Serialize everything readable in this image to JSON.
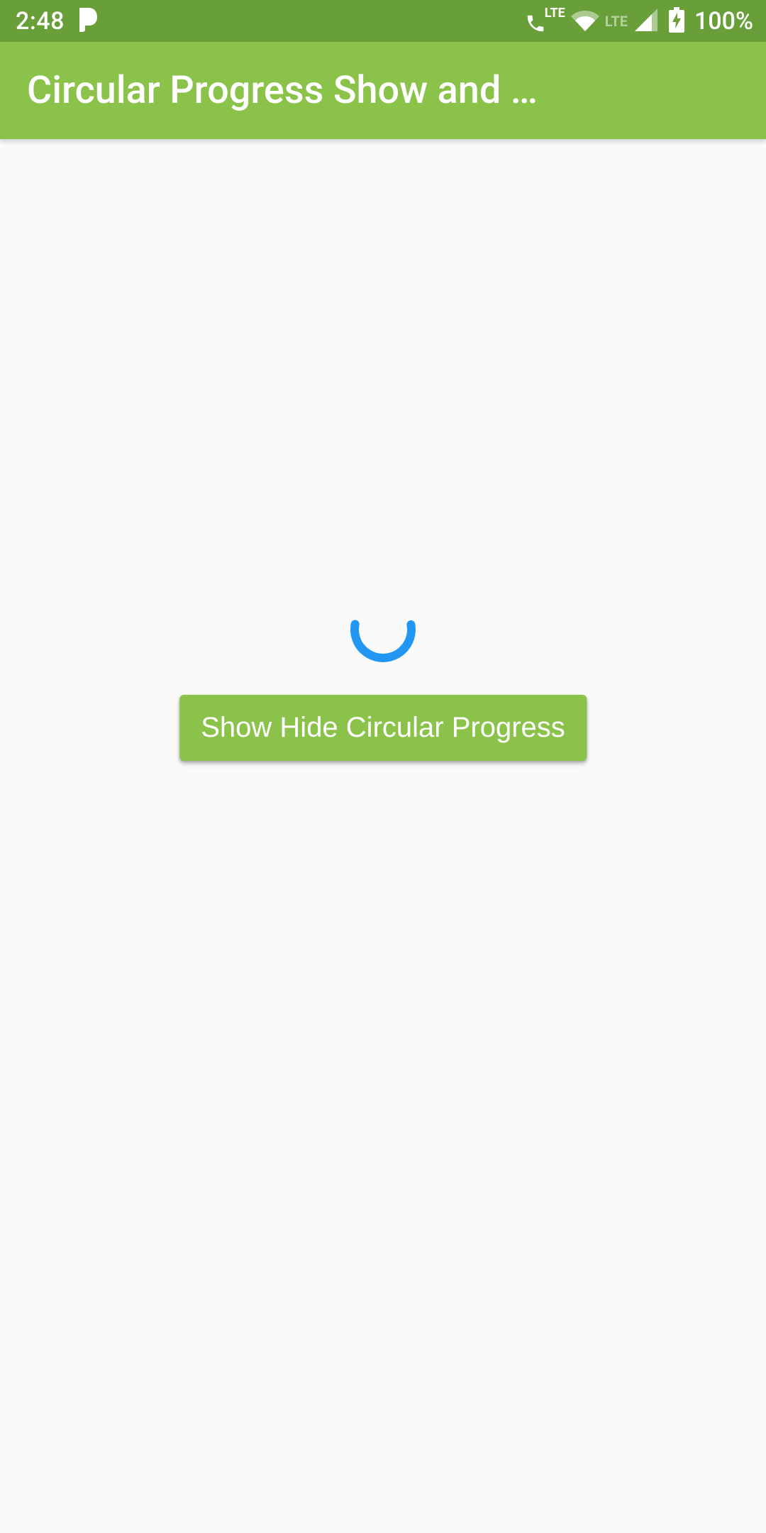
{
  "status": {
    "time": "2:48",
    "lte_label": "LTE",
    "lte_dim_label": "LTE",
    "battery_pct": "100%"
  },
  "appbar": {
    "title": "Circular Progress Show and …"
  },
  "main": {
    "button_label": "Show Hide Circular Progress"
  },
  "colors": {
    "status_bar": "#689F38",
    "app_bar": "#8BC34A",
    "spinner": "#2196F3"
  }
}
